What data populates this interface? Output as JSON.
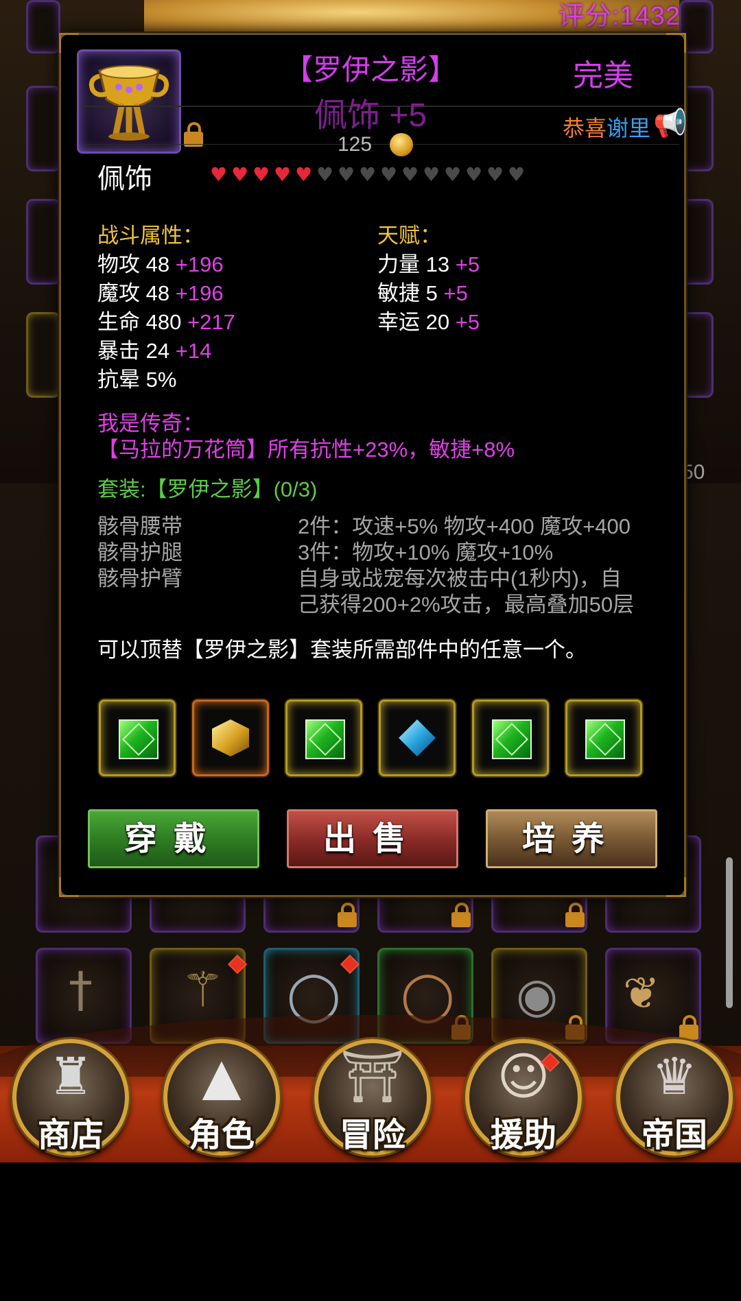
{
  "header": {
    "score_text": "评分:1432"
  },
  "item": {
    "title": "【罗伊之影】",
    "subtitle": "佩饰  +5",
    "quality": "完美",
    "type": "佩饰",
    "price": "125",
    "stars_filled": 5,
    "stars_total": 15,
    "icon": "golden-chalice-icon",
    "locked": true
  },
  "notice": {
    "prefix": "恭喜",
    "suffix": "谢里",
    "icon": "megaphone-icon"
  },
  "combat": {
    "heading": "战斗属性：",
    "stats": [
      {
        "name": "物攻 48",
        "bonus": "+196"
      },
      {
        "name": "魔攻 48",
        "bonus": "+196"
      },
      {
        "name": "生命 480",
        "bonus": "+217"
      },
      {
        "name": "暴击 24",
        "bonus": "+14"
      },
      {
        "name": "抗晕 5%",
        "bonus": ""
      }
    ]
  },
  "talent": {
    "heading": "天赋：",
    "stats": [
      {
        "name": "力量 13",
        "bonus": "+5"
      },
      {
        "name": "敏捷 5",
        "bonus": "+5"
      },
      {
        "name": "幸运 20",
        "bonus": "+5"
      }
    ]
  },
  "legend": {
    "heading": "我是传奇：",
    "text": "【马拉的万花筒】所有抗性+23%，敏捷+8%"
  },
  "set": {
    "heading": "套装:【罗伊之影】(0/3)",
    "pieces": [
      "骸骨腰带",
      "骸骨护腿",
      "骸骨护臂"
    ],
    "bonuses": [
      "2件：攻速+5% 物攻+400 魔攻+400",
      "3件：物攻+10% 魔攻+10%",
      "自身或战宠每次被击中(1秒内)，自",
      "己获得200+2%攻击，最高叠加50层"
    ]
  },
  "description": "可以顶替【罗伊之影】套装所需部件中的任意一个。",
  "gems": [
    "green",
    "yellow",
    "green",
    "blue",
    "green",
    "green"
  ],
  "buttons": {
    "wear": "穿戴",
    "sell": "出售",
    "train": "培养"
  },
  "nav": [
    {
      "label": "商店",
      "icon": "castle-icon"
    },
    {
      "label": "角色",
      "icon": "hooded-figure-icon"
    },
    {
      "label": "冒险",
      "icon": "dungeon-gate-icon"
    },
    {
      "label": "援助",
      "icon": "helper-girl-icon"
    },
    {
      "label": "帝国",
      "icon": "crown-icon"
    }
  ],
  "bg_side_value": "50",
  "colors": {
    "legend_magenta": "#e040e8",
    "set_green": "#5ccd46",
    "heading_yellow": "#f2c33c",
    "heart_red": "#e8283a"
  }
}
